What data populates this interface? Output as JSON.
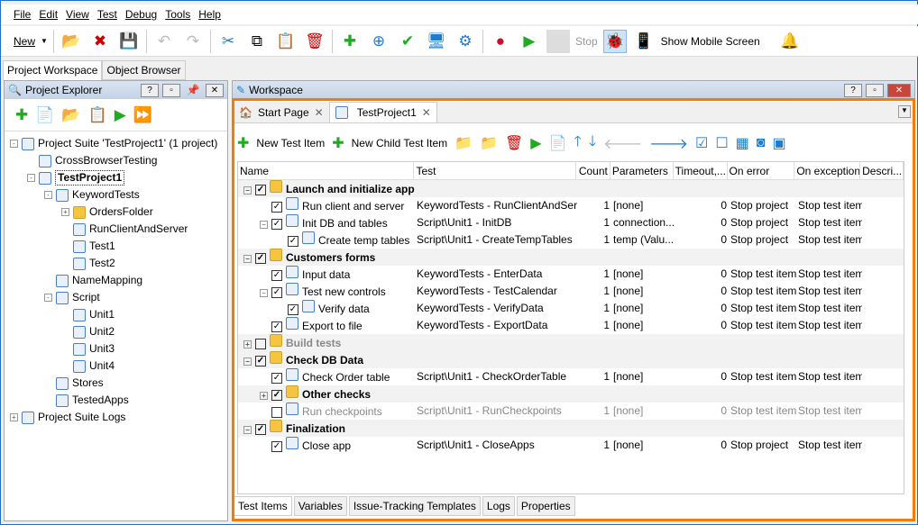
{
  "menu": [
    "File",
    "Edit",
    "View",
    "Test",
    "Debug",
    "Tools",
    "Help"
  ],
  "toolbar": {
    "new_label": "New",
    "stop_label": "Stop",
    "show_mobile_label": "Show Mobile Screen"
  },
  "top_tabs": [
    "Project Workspace",
    "Object Browser"
  ],
  "explorer": {
    "title": "Project Explorer",
    "tree": [
      {
        "level": 0,
        "label": "Project Suite 'TestProject1' (1 project)",
        "exp": "-"
      },
      {
        "level": 1,
        "label": "CrossBrowserTesting"
      },
      {
        "level": 1,
        "label": "TestProject1",
        "exp": "-",
        "bold": true
      },
      {
        "level": 2,
        "label": "KeywordTests",
        "exp": "-"
      },
      {
        "level": 3,
        "label": "OrdersFolder",
        "exp": "+"
      },
      {
        "level": 3,
        "label": "RunClientAndServer"
      },
      {
        "level": 3,
        "label": "Test1"
      },
      {
        "level": 3,
        "label": "Test2"
      },
      {
        "level": 2,
        "label": "NameMapping"
      },
      {
        "level": 2,
        "label": "Script",
        "exp": "-"
      },
      {
        "level": 3,
        "label": "Unit1"
      },
      {
        "level": 3,
        "label": "Unit2"
      },
      {
        "level": 3,
        "label": "Unit3"
      },
      {
        "level": 3,
        "label": "Unit4"
      },
      {
        "level": 2,
        "label": "Stores"
      },
      {
        "level": 2,
        "label": "TestedApps"
      },
      {
        "level": 0,
        "label": "Project Suite Logs",
        "exp": "+"
      }
    ]
  },
  "workspace": {
    "title": "Workspace",
    "tabs": [
      "Start Page",
      "TestProject1"
    ],
    "toolbar": {
      "new_test_item": "New Test Item",
      "new_child_test_item": "New Child Test Item"
    },
    "columns": [
      "Name",
      "Test",
      "Count",
      "Parameters",
      "Timeout,...",
      "On error",
      "On exception",
      "Descri..."
    ],
    "rows": [
      {
        "level": 0,
        "group": true,
        "checked": true,
        "name": "Launch and initialize applications"
      },
      {
        "level": 1,
        "checked": true,
        "name": "Run client and server",
        "test": "KeywordTests - RunClientAndServer",
        "count": "1",
        "params": "[none]",
        "timeout": "0",
        "on_error": "Stop project",
        "on_exception": "Stop test item"
      },
      {
        "level": 1,
        "checked": true,
        "name": "Init DB and tables",
        "test": "Script\\Unit1 - InitDB",
        "count": "1",
        "params": "connection...",
        "timeout": "0",
        "on_error": "Stop project",
        "on_exception": "Stop test item"
      },
      {
        "level": 2,
        "checked": true,
        "name": "Create temp tables",
        "test": "Script\\Unit1 - CreateTempTables",
        "count": "1",
        "params": "temp (Valu...",
        "timeout": "0",
        "on_error": "Stop project",
        "on_exception": "Stop test item"
      },
      {
        "level": 0,
        "group": true,
        "checked": true,
        "name": "Customers forms"
      },
      {
        "level": 1,
        "checked": true,
        "name": "Input data",
        "test": "KeywordTests - EnterData",
        "count": "1",
        "params": "[none]",
        "timeout": "0",
        "on_error": "Stop test item",
        "on_exception": "Stop test item"
      },
      {
        "level": 1,
        "checked": true,
        "name": "Test new controls",
        "test": "KeywordTests - TestCalendar",
        "count": "1",
        "params": "[none]",
        "timeout": "0",
        "on_error": "Stop test item",
        "on_exception": "Stop test item"
      },
      {
        "level": 2,
        "checked": true,
        "name": "Verify data",
        "test": "KeywordTests - VerifyData",
        "count": "1",
        "params": "[none]",
        "timeout": "0",
        "on_error": "Stop test item",
        "on_exception": "Stop test item"
      },
      {
        "level": 1,
        "checked": true,
        "name": "Export to file",
        "test": "KeywordTests - ExportData",
        "count": "1",
        "params": "[none]",
        "timeout": "0",
        "on_error": "Stop test item",
        "on_exception": "Stop test item"
      },
      {
        "level": 0,
        "group": true,
        "checked": false,
        "disabled": true,
        "name": "Build tests"
      },
      {
        "level": 0,
        "group": true,
        "checked": true,
        "name": "Check DB Data"
      },
      {
        "level": 1,
        "checked": true,
        "name": "Check Order table",
        "test": "Script\\Unit1 - CheckOrderTable",
        "count": "1",
        "params": "[none]",
        "timeout": "0",
        "on_error": "Stop test item",
        "on_exception": "Stop test item"
      },
      {
        "level": 1,
        "group": true,
        "checked": true,
        "name": "Other checks"
      },
      {
        "level": 1,
        "checked": false,
        "disabled": true,
        "name": "Run checkpoints",
        "test": "Script\\Unit1 - RunCheckpoints",
        "count": "1",
        "params": "[none]",
        "timeout": "0",
        "on_error": "Stop test item",
        "on_exception": "Stop test item"
      },
      {
        "level": 0,
        "group": true,
        "checked": true,
        "name": "Finalization"
      },
      {
        "level": 1,
        "checked": true,
        "name": "Close app",
        "test": "Script\\Unit1 - CloseApps",
        "count": "1",
        "params": "[none]",
        "timeout": "0",
        "on_error": "Stop project",
        "on_exception": "Stop test item"
      }
    ],
    "bottom_tabs": [
      "Test Items",
      "Variables",
      "Issue-Tracking Templates",
      "Logs",
      "Properties"
    ]
  },
  "colors": {
    "accent": "#f57c00",
    "folder": "#f5c542"
  }
}
